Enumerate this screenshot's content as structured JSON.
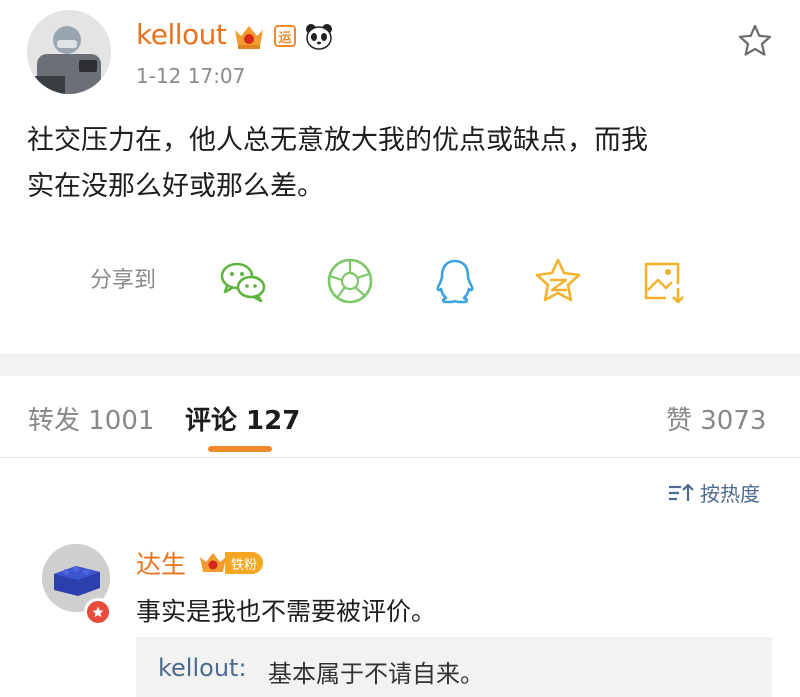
{
  "post": {
    "author": "kellout",
    "yun_badge": "运",
    "time": "1-12 17:07",
    "text_line1": "社交压力在，他人总无意放大我的优点或缺点，而我",
    "text_line2": "实在没那么好或那么差。"
  },
  "share": {
    "label": "分享到",
    "icons": [
      "wechat-icon",
      "moments-icon",
      "qq-icon",
      "qzone-icon",
      "save-image-icon"
    ]
  },
  "tabs": {
    "repost": "转发 1001",
    "comments": "评论 127",
    "likes": "赞 3073"
  },
  "sort": {
    "label": "按热度"
  },
  "comment": {
    "author": "达生",
    "fan_badge": "铁粉",
    "text": "事实是我也不需要被评价。",
    "reply_author": "kellout:",
    "reply_text": "基本属于不请自来。"
  },
  "colors": {
    "author": "#e8731c",
    "link_blue": "#4d6a8f",
    "accent_orange": "#f08a2a",
    "wechat_green": "#5fb440",
    "qq_blue": "#3aa3e0",
    "qzone_yellow": "#f2b22c"
  }
}
